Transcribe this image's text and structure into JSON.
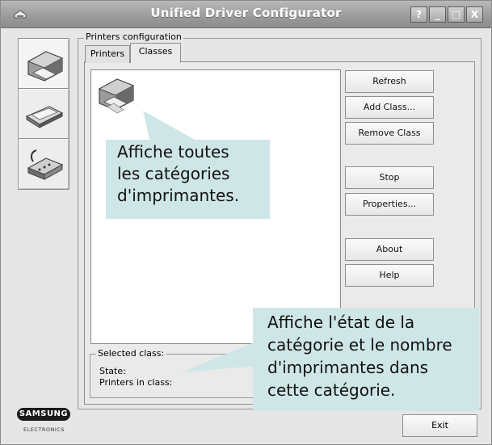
{
  "window": {
    "title": "Unified Driver Configurator",
    "controls": [
      "?",
      "_",
      "□",
      "X"
    ]
  },
  "nav": [
    {
      "icon": "printer-icon"
    },
    {
      "icon": "scanner-icon"
    },
    {
      "icon": "port-icon"
    }
  ],
  "group": {
    "label": "Printers configuration"
  },
  "tabs": [
    {
      "label": "Printers",
      "active": false
    },
    {
      "label": "Classes",
      "active": true
    }
  ],
  "buttons": {
    "refresh": "Refresh",
    "add_class": "Add Class...",
    "remove_class": "Remove Class",
    "stop": "Stop",
    "properties": "Properties...",
    "about": "About",
    "help": "Help",
    "exit": "Exit"
  },
  "selected_class": {
    "title": "Selected class:",
    "state_label": "State:",
    "printers_label": "Printers in class:"
  },
  "logo": {
    "brand": "SAMSUNG",
    "sub": "ELECTRONICS"
  },
  "callouts": {
    "classes_lines": [
      "Affiche toutes",
      "les catégories",
      "d'imprimantes."
    ],
    "state_lines": [
      "Affiche l'état de la",
      "catégorie et le nombre",
      "d'imprimantes dans",
      "cette catégorie."
    ]
  }
}
